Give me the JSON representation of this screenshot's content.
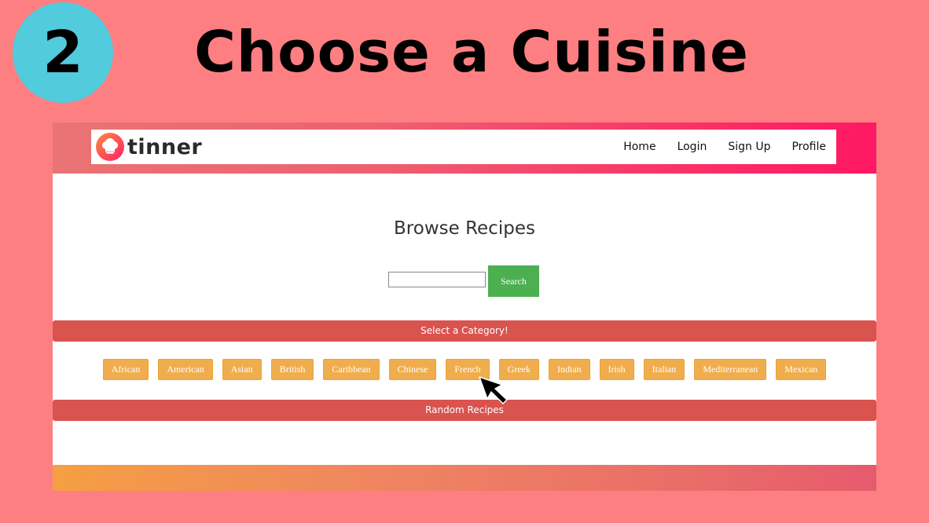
{
  "slide": {
    "step_number": "2",
    "title": "Choose a Cuisine"
  },
  "app": {
    "logo_text": "tinner",
    "nav": [
      {
        "label": "Home"
      },
      {
        "label": "Login"
      },
      {
        "label": "Sign Up"
      },
      {
        "label": "Profile"
      }
    ]
  },
  "main": {
    "heading": "Browse Recipes",
    "search": {
      "value": "",
      "placeholder": "",
      "button_label": "Search"
    },
    "category_bar_label": "Select a Category!",
    "categories": [
      {
        "label": "African"
      },
      {
        "label": "American"
      },
      {
        "label": "Asian"
      },
      {
        "label": "British"
      },
      {
        "label": "Caribbean"
      },
      {
        "label": "Chinese"
      },
      {
        "label": "French"
      },
      {
        "label": "Greek"
      },
      {
        "label": "Indian"
      },
      {
        "label": "Irish"
      },
      {
        "label": "Italian"
      },
      {
        "label": "Mediterranean"
      },
      {
        "label": "Mexican"
      }
    ],
    "random_bar_label": "Random Recipes"
  },
  "colors": {
    "slide_background": "#fd7f82",
    "step_circle": "#52cbdc",
    "search_button": "#4caf50",
    "section_bar": "#d9534f",
    "category_button": "#f0ad4e",
    "header_gradient_end": "#ff1763"
  },
  "icons": {
    "logo": "chef-hat-icon",
    "pointer": "mouse-cursor-icon"
  }
}
